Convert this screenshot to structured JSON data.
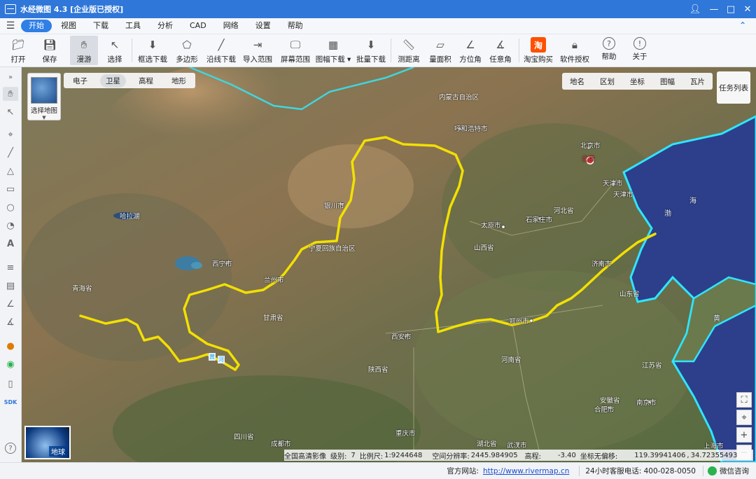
{
  "window": {
    "title": "水经微图 4.3 [企业版已授权]"
  },
  "menu": [
    "开始",
    "视图",
    "下载",
    "工具",
    "分析",
    "CAD",
    "网络",
    "设置",
    "帮助"
  ],
  "toolbar": {
    "open": "打开",
    "save": "保存",
    "pan": "漫游",
    "select": "选择",
    "box_download": "框选下载",
    "polygon": "多边形",
    "line_download": "沿线下载",
    "import_range": "导入范围",
    "screen_range": "屏幕范围",
    "sheet_download": "图幅下载",
    "batch_download": "批量下载",
    "measure_distance": "测距离",
    "measure_area": "量面积",
    "bearing": "方位角",
    "any_angle": "任意角",
    "taobao": "淘宝购买",
    "license": "软件授权",
    "help": "帮助",
    "about": "关于"
  },
  "map_selector": {
    "label": "选择地图"
  },
  "map_types": [
    "电子",
    "卫星",
    "高程",
    "地形"
  ],
  "layer_buttons": [
    "地名",
    "区划",
    "坐标",
    "图幅",
    "瓦片"
  ],
  "task_list": "任务列表",
  "earth_label": "地球",
  "labels": {
    "inner_mongolia": "内蒙古自治区",
    "hohhot": "呼和浩特市",
    "beijing_city": "北京市",
    "beijing": "北京",
    "tianjin_city": "天津市",
    "tianjin": "天津市",
    "hebei": "河北省",
    "shijiazhuang": "石家庄市",
    "taiyuan": "太原市",
    "shanxi": "山西省",
    "yinchuan": "银川市",
    "ningxia": "宁夏回族自治区",
    "xining": "西宁市",
    "lanzhou": "兰州市",
    "gansu": "甘肃省",
    "qinghai": "青海省",
    "qinghai_lake": "哈拉湖",
    "xian": "西安市",
    "shaanxi": "陕西省",
    "zhengzhou": "郑州市",
    "henan": "河南省",
    "jinan": "济南市",
    "shandong": "山东省",
    "jiangsu": "江苏省",
    "anhui": "安徽省",
    "hefei": "合肥市",
    "nanjing": "南京市",
    "shanghai": "上海市",
    "wuhan": "武汉市",
    "hubei": "湖北省",
    "chongqing": "重庆市",
    "chengdu": "成都市",
    "sichuan": "四川省",
    "bohai_1": "渤",
    "bohai_2": "海",
    "yellow_sea": "黄",
    "river_1": "黄",
    "river_2": "河"
  },
  "map_info": {
    "imagery": "全国高清影像",
    "level_label": "级别:",
    "level": "7",
    "scale_label": "比例尺:",
    "scale": "1:9244648",
    "resolution_label": "空间分辨率:",
    "resolution": "2445.984905",
    "elevation_label": "高程:",
    "elevation": "-3.40",
    "offset_label": "坐标无偏移:",
    "lon": "119.39941406",
    "lat": "34.72355493"
  },
  "status": {
    "site_label": "官方网站:",
    "site_url": "http://www.rivermap.cn",
    "hotline": "24小时客服电话: 400-028-0050",
    "wechat": "微信咨询"
  },
  "colors": {
    "titlebar": "#2f77d8",
    "menu_active": "#2f7fe6",
    "river_line": "#f2e000",
    "coastline": "#2ee6ff",
    "sea": "#2d3f8a"
  }
}
